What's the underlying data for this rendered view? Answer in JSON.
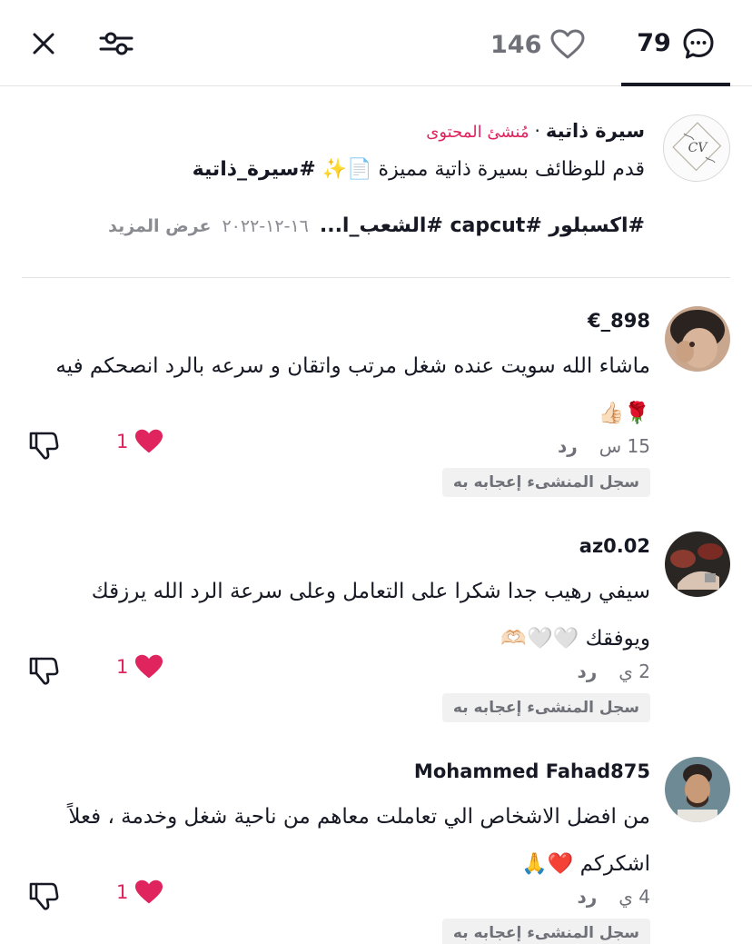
{
  "header": {
    "likes_count": "146",
    "comments_count": "79",
    "icons": {
      "close": "close-icon",
      "filter": "sliders-icon",
      "likes": "heart-outline-icon",
      "comments": "comment-bubble-icon"
    }
  },
  "description": {
    "creator_name": "سيرة ذاتية",
    "creator_dot": "·",
    "creator_role": "مُنشئ المحتوى",
    "caption_text": "قدم للوظائف بسيرة ذاتية مميزة",
    "caption_emojis": "📄✨",
    "caption_tag": "#سيرة_ذاتية",
    "tags_text": "#اكسبلور #capcut #الشعب_ا...",
    "date": "١٦-١٢-٢٠٢٢",
    "see_more": "عرض المزيد",
    "avatar_text": "CV"
  },
  "comments": [
    {
      "username": "€_898",
      "text": "ماشاء الله سويت عنده شغل مرتب واتقان و سرعه بالرد انصحكم فيه 🌹👍🏻",
      "time": "15 س",
      "reply_label": "رد",
      "like_count": "1",
      "creator_liked": "سجل المنشىء إعجابه به"
    },
    {
      "username": "az0.02",
      "text": "سيفي رهيب جدا شكرا على التعامل وعلى سرعة الرد الله يرزقك ويوفقك 🤍🤍🫶🏻",
      "time": "2 ي",
      "reply_label": "رد",
      "like_count": "1",
      "creator_liked": "سجل المنشىء إعجابه به"
    },
    {
      "username": "Mohammed Fahad875",
      "text": "من افضل الاشخاص الي تعاملت معاهم من ناحية شغل وخدمة ، فعلاً اشكركم ❤️🙏",
      "time": "4 ي",
      "reply_label": "رد",
      "like_count": "1",
      "creator_liked": "سجل المنشىء إعجابه به"
    }
  ],
  "colors": {
    "accent_red": "#e0245e",
    "text_primary": "#161823",
    "text_secondary": "#6f7078",
    "divider": "#e3e3e4"
  }
}
